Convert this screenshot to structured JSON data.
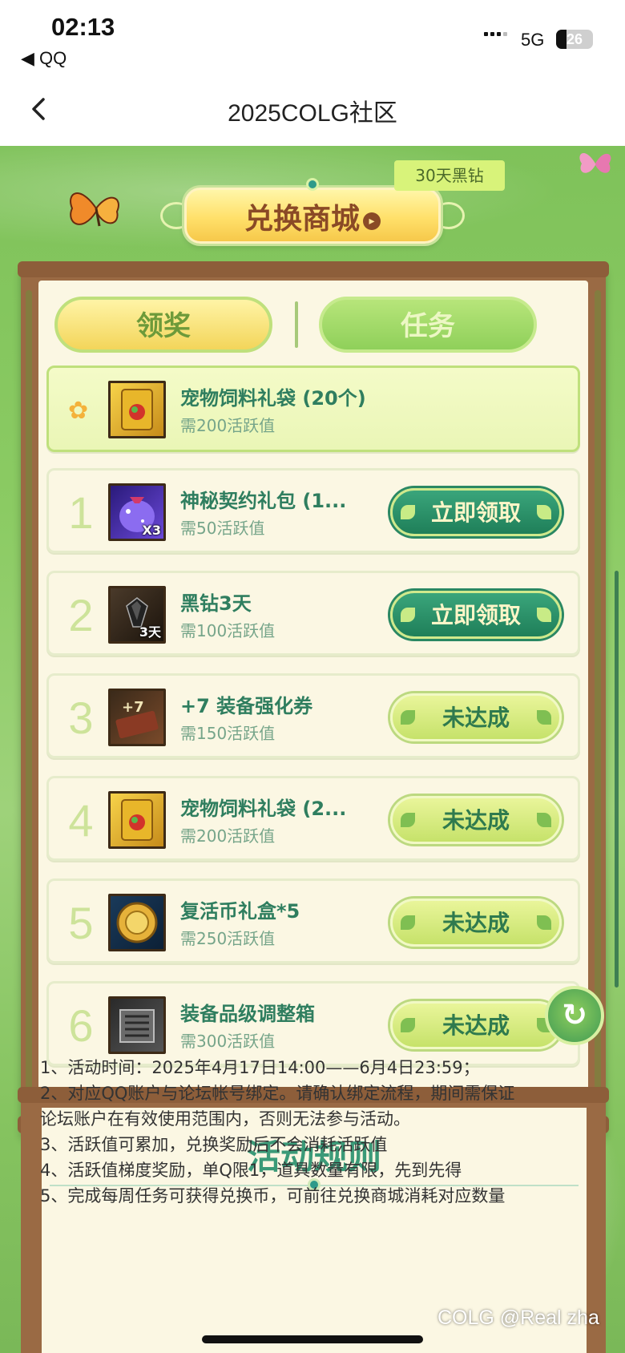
{
  "status_bar": {
    "time": "02:13",
    "back_app": "◀ QQ",
    "network": "5G",
    "battery": "26"
  },
  "nav": {
    "title": "2025COLG社区"
  },
  "banner": {
    "mall_label": "兑换商城",
    "tag": "30天黑钻"
  },
  "tabs": {
    "claim": "领奖",
    "task": "任务"
  },
  "pinned_item": {
    "name": "宠物饲料礼袋 (20个)",
    "requirement": "需200活跃值",
    "icon": "pet-food-bag-icon"
  },
  "rewards": [
    {
      "rank": "1",
      "name": "神秘契约礼包 (1...",
      "requirement": "需50活跃值",
      "button": "立即领取",
      "status": "claimable",
      "icon": "mystery-contract-bag-icon",
      "icon_sub": "X3"
    },
    {
      "rank": "2",
      "name": "黑钻3天",
      "requirement": "需100活跃值",
      "button": "立即领取",
      "status": "claimable",
      "icon": "black-diamond-icon",
      "icon_sub": "3天"
    },
    {
      "rank": "3",
      "name": "+7 装备强化券",
      "requirement": "需150活跃值",
      "button": "未达成",
      "status": "locked",
      "icon": "enhance-ticket-icon",
      "icon_sub": ""
    },
    {
      "rank": "4",
      "name": "宠物饲料礼袋 (2...",
      "requirement": "需200活跃值",
      "button": "未达成",
      "status": "locked",
      "icon": "pet-food-bag-icon",
      "icon_sub": ""
    },
    {
      "rank": "5",
      "name": "复活币礼盒*5",
      "requirement": "需250活跃值",
      "button": "未达成",
      "status": "locked",
      "icon": "revive-coin-icon",
      "icon_sub": ""
    },
    {
      "rank": "6",
      "name": "装备品级调整箱",
      "requirement": "需300活跃值",
      "button": "未达成",
      "status": "locked",
      "icon": "grade-adjust-box-icon",
      "icon_sub": ""
    }
  ],
  "rules": {
    "title": "活动规则",
    "lines": [
      "1、活动时间：2025年4月17日14:00——6月4日23:59；",
      "2、对应QQ账户与论坛帐号绑定。请确认绑定流程，期间需保证",
      "论坛账户在有效使用范围内，否则无法参与活动。",
      "3、活跃值可累加，兑换奖励后不会消耗活跃值",
      "4、活跃值梯度奖励，单Q限1，道具数量有限，先到先得",
      "5、完成每周任务可获得兑换币，可前往兑换商城消耗对应数量"
    ]
  },
  "watermark": "COLG @Real zha",
  "colors": {
    "accent_green": "#2f7e5f",
    "claim_button": "#1f7f59",
    "locked_button": "#c6e26a",
    "wood": "#9a6a44"
  }
}
